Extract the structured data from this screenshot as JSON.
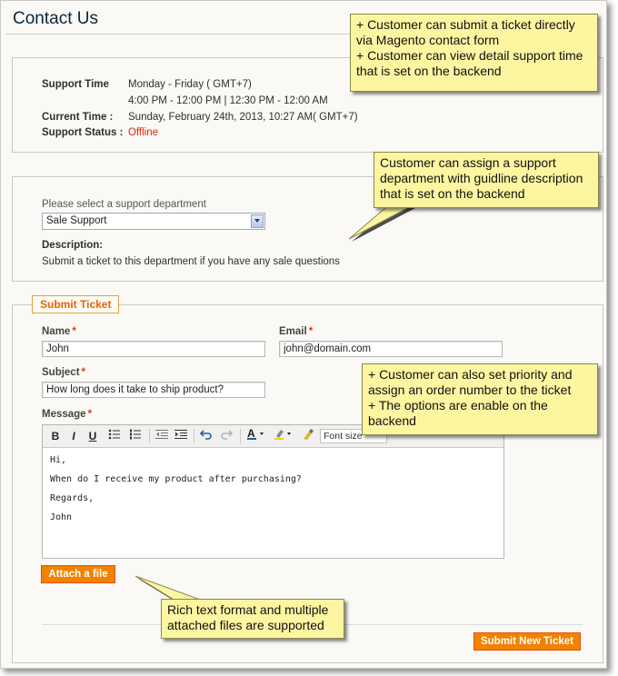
{
  "page": {
    "title": "Contact Us"
  },
  "support_info": {
    "support_time_label": "Support Time",
    "support_time_days": "Monday - Friday ( GMT+7)",
    "support_time_hours": "4:00 PM - 12:00 PM | 12:30 PM - 12:00 AM",
    "current_time_label": "Current Time :",
    "current_time_value": "Sunday, February 24th, 2013, 10:27 AM( GMT+7)",
    "support_status_label": "Support Status :",
    "support_status_value": "Offline"
  },
  "department": {
    "select_label": "Please select a support department",
    "selected": "Sale Support",
    "description_label": "Description:",
    "description_text": "Submit a ticket to this department if you have any sale questions"
  },
  "ticket": {
    "legend": "Submit Ticket",
    "name_label": "Name",
    "name_value": "John",
    "email_label": "Email",
    "email_value": "john@domain.com",
    "subject_label": "Subject",
    "subject_value": "How long does it take to ship product?",
    "message_label": "Message",
    "required_mark": "*",
    "message_lines": [
      "Hi,",
      "When do I receive my product after purchasing?",
      "Regards,",
      "John"
    ],
    "toolbar": {
      "bold": "B",
      "italic": "I",
      "underline": "U",
      "font_size_placeholder": "Font size"
    },
    "attach_button": "Attach a file",
    "submit_button": "Submit New Ticket"
  },
  "callouts": {
    "c1_line1": "+ Customer can submit a ticket directly",
    "c1_line2": "via Magento contact form",
    "c1_line3": "+ Customer can view detail support time",
    "c1_line4": "that is set on the backend",
    "c2_line1": "Customer can assign a support",
    "c2_line2": "department with guidline description",
    "c2_line3": "that is set on the backend",
    "c3_line1": "+ Customer can also set priority and",
    "c3_line2": "assign an order number to the ticket",
    "c3_line3": "+ The options are enable on the",
    "c3_line4": "backend",
    "c4_line1": "Rich text format and multiple",
    "c4_line2": "attached files are supported"
  },
  "colors": {
    "accent_orange": "#f18200",
    "offline_red": "#df280a",
    "callout_yellow": "#fcf6a1",
    "title_navy": "#0a263c"
  }
}
